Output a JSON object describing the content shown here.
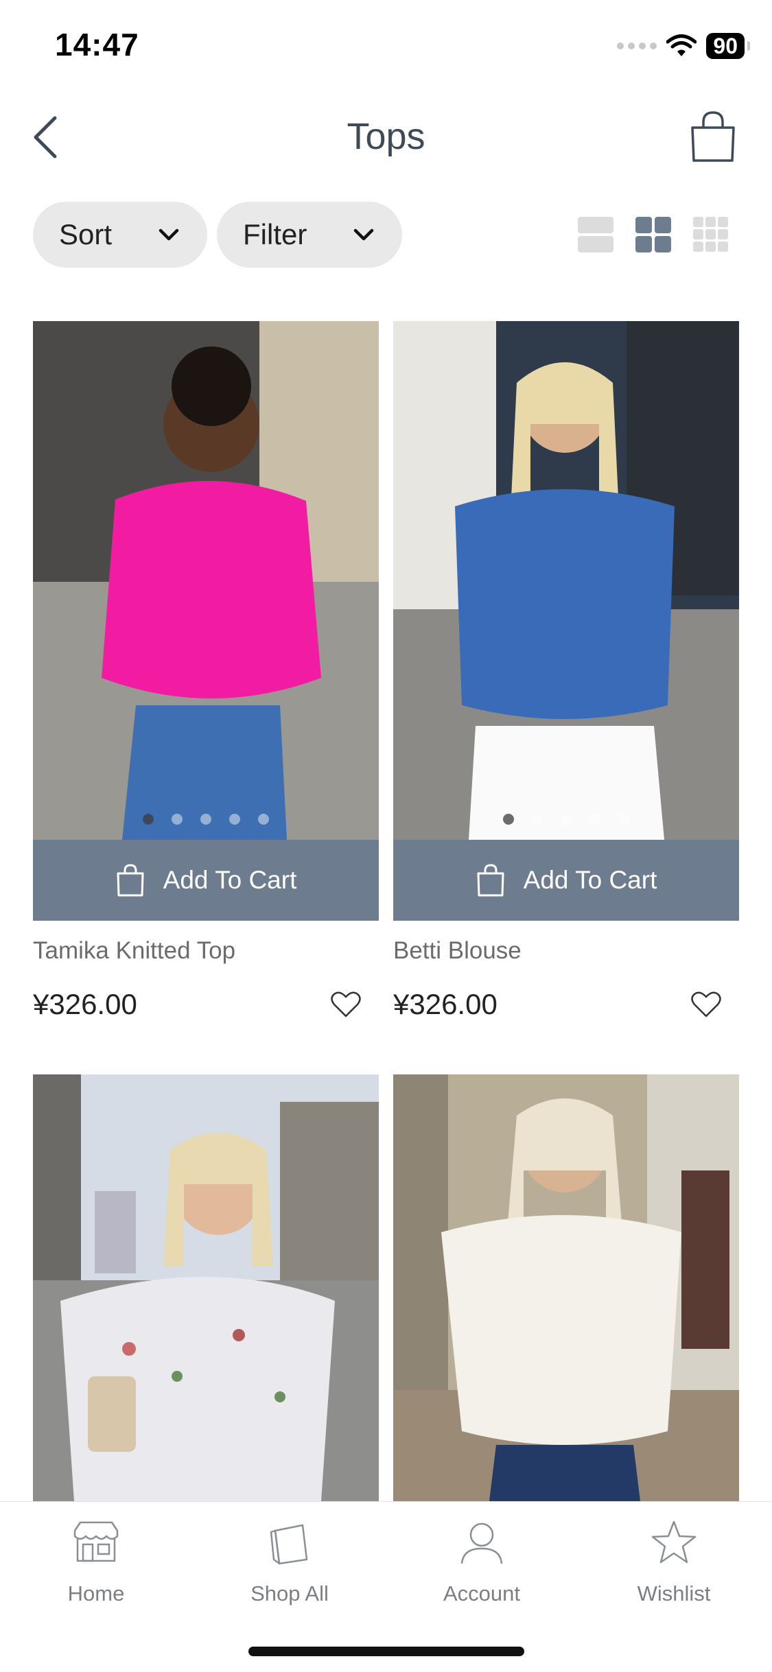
{
  "status_bar": {
    "time": "14:47",
    "battery": "90"
  },
  "header": {
    "title": "Tops"
  },
  "filters": {
    "sort_label": "Sort",
    "filter_label": "Filter"
  },
  "products": [
    {
      "name": "Tamika Knitted Top",
      "price": "¥326.00",
      "add_to_cart": "Add To Cart"
    },
    {
      "name": "Betti Blouse",
      "price": "¥326.00",
      "add_to_cart": "Add To Cart"
    }
  ],
  "nav": {
    "home": "Home",
    "shop_all": "Shop All",
    "account": "Account",
    "wishlist": "Wishlist"
  },
  "colors": {
    "accent": "#6d7c8e",
    "title": "#3f4a58",
    "pill": "#e9e9e9"
  }
}
